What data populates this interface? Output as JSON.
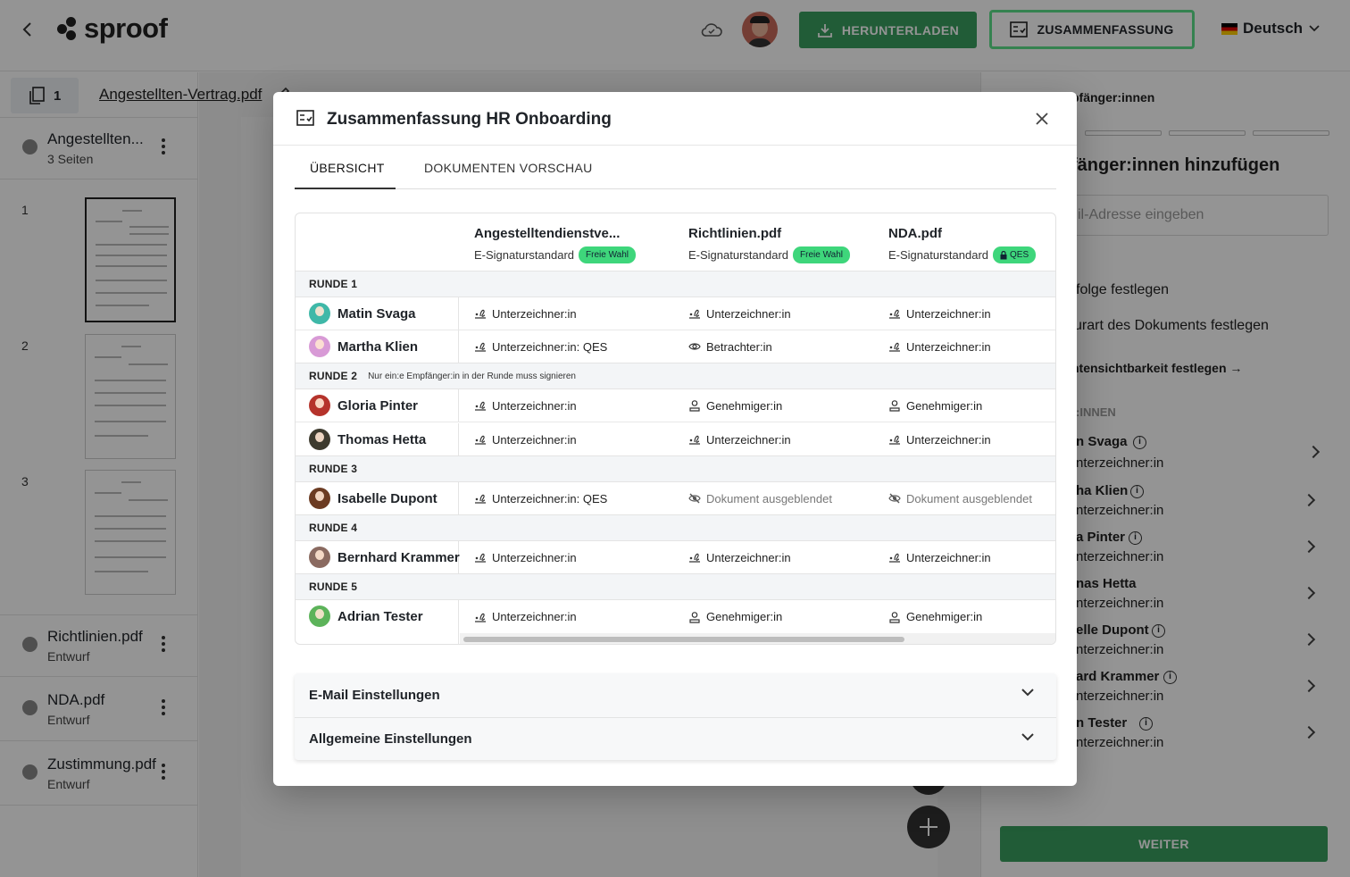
{
  "app": {
    "logo_text": "sproof",
    "download_label": "HERUNTERLADEN",
    "summary_label": "ZUSAMMENFASSUNG",
    "language": "Deutsch"
  },
  "sidebar": {
    "page_count": "1",
    "documents": [
      {
        "name": "Angestellten...",
        "sub": "3 Seiten"
      },
      {
        "name": "Richtlinien.pdf",
        "sub": "Entwurf"
      },
      {
        "name": "NDA.pdf",
        "sub": "Entwurf"
      },
      {
        "name": "Zustimmung.pdf",
        "sub": "Entwurf"
      }
    ],
    "thumb_numbers": [
      "1",
      "2",
      "3"
    ]
  },
  "canvas": {
    "doc_title": "Angestellten-Vertrag.pdf"
  },
  "right_panel": {
    "heading_partial": "pfänger:innen",
    "add_title_partial": "fänger:innen hinzufügen",
    "email_placeholder_partial": "il-Adresse eingeben",
    "order_partial": "folge festlegen",
    "type_partial": "urart des Dokuments festlegen",
    "visibility_partial": "ntensichtbarkeit festlegen →",
    "list_header_partial": ":INNEN",
    "recipients": [
      {
        "name": "n Svaga",
        "role": "nterzeichner:in"
      },
      {
        "name": "ha Klien",
        "role": "nterzeichner:in"
      },
      {
        "name": "a Pinter",
        "role": "nterzeichner:in"
      },
      {
        "name": "nas Hetta",
        "role": "nterzeichner:in"
      },
      {
        "name": "elle Dupont",
        "role": "nterzeichner:in"
      },
      {
        "name": "ard Krammer",
        "role": "nterzeichner:in"
      },
      {
        "name": "n Tester",
        "role": "nterzeichner:in"
      }
    ],
    "next_label": "WEITER"
  },
  "modal": {
    "title": "Zusammenfassung HR Onboarding",
    "tabs": [
      "ÜBERSICHT",
      "DOKUMENTEN VORSCHAU"
    ],
    "documents": [
      {
        "name": "Angestelltendienstve...",
        "standard": "E-Signaturstandard",
        "badge": "Freie Wahl"
      },
      {
        "name": "Richtlinien.pdf",
        "standard": "E-Signaturstandard",
        "badge": "Freie Wahl"
      },
      {
        "name": "NDA.pdf",
        "standard": "E-Signaturstandard",
        "badge": "QES"
      }
    ],
    "rounds": [
      {
        "label": "RUNDE 1",
        "note": "",
        "people": [
          {
            "name": "Matin Svaga",
            "roles": [
              "Unterzeichner:in",
              "Unterzeichner:in",
              "Unterzeichner:in"
            ]
          },
          {
            "name": "Martha Klien",
            "roles": [
              "Unterzeichner:in: QES",
              "Betrachter:in",
              "Unterzeichner:in"
            ]
          }
        ]
      },
      {
        "label": "RUNDE 2",
        "note": "Nur ein:e Empfänger:in in der Runde muss signieren",
        "people": [
          {
            "name": "Gloria Pinter",
            "roles": [
              "Unterzeichner:in",
              "Genehmiger:in",
              "Genehmiger:in"
            ]
          },
          {
            "name": "Thomas Hetta",
            "roles": [
              "Unterzeichner:in",
              "Unterzeichner:in",
              "Unterzeichner:in"
            ]
          }
        ]
      },
      {
        "label": "RUNDE 3",
        "note": "",
        "people": [
          {
            "name": "Isabelle Dupont",
            "roles": [
              "Unterzeichner:in: QES",
              "Dokument ausgeblendet",
              "Dokument ausgeblendet"
            ]
          }
        ]
      },
      {
        "label": "RUNDE 4",
        "note": "",
        "people": [
          {
            "name": "Bernhard Krammer",
            "roles": [
              "Unterzeichner:in",
              "Unterzeichner:in",
              "Unterzeichner:in"
            ]
          }
        ]
      },
      {
        "label": "RUNDE 5",
        "note": "",
        "people": [
          {
            "name": "Adrian Tester",
            "roles": [
              "Unterzeichner:in",
              "Genehmiger:in",
              "Genehmiger:in"
            ]
          }
        ]
      }
    ],
    "accordions": [
      "E-Mail Einstellungen",
      "Allgemeine Einstellungen"
    ]
  },
  "colors": {
    "primary_green": "#3a9f5f",
    "badge_green": "#3ed67b",
    "summary_border": "#5ce08a"
  }
}
